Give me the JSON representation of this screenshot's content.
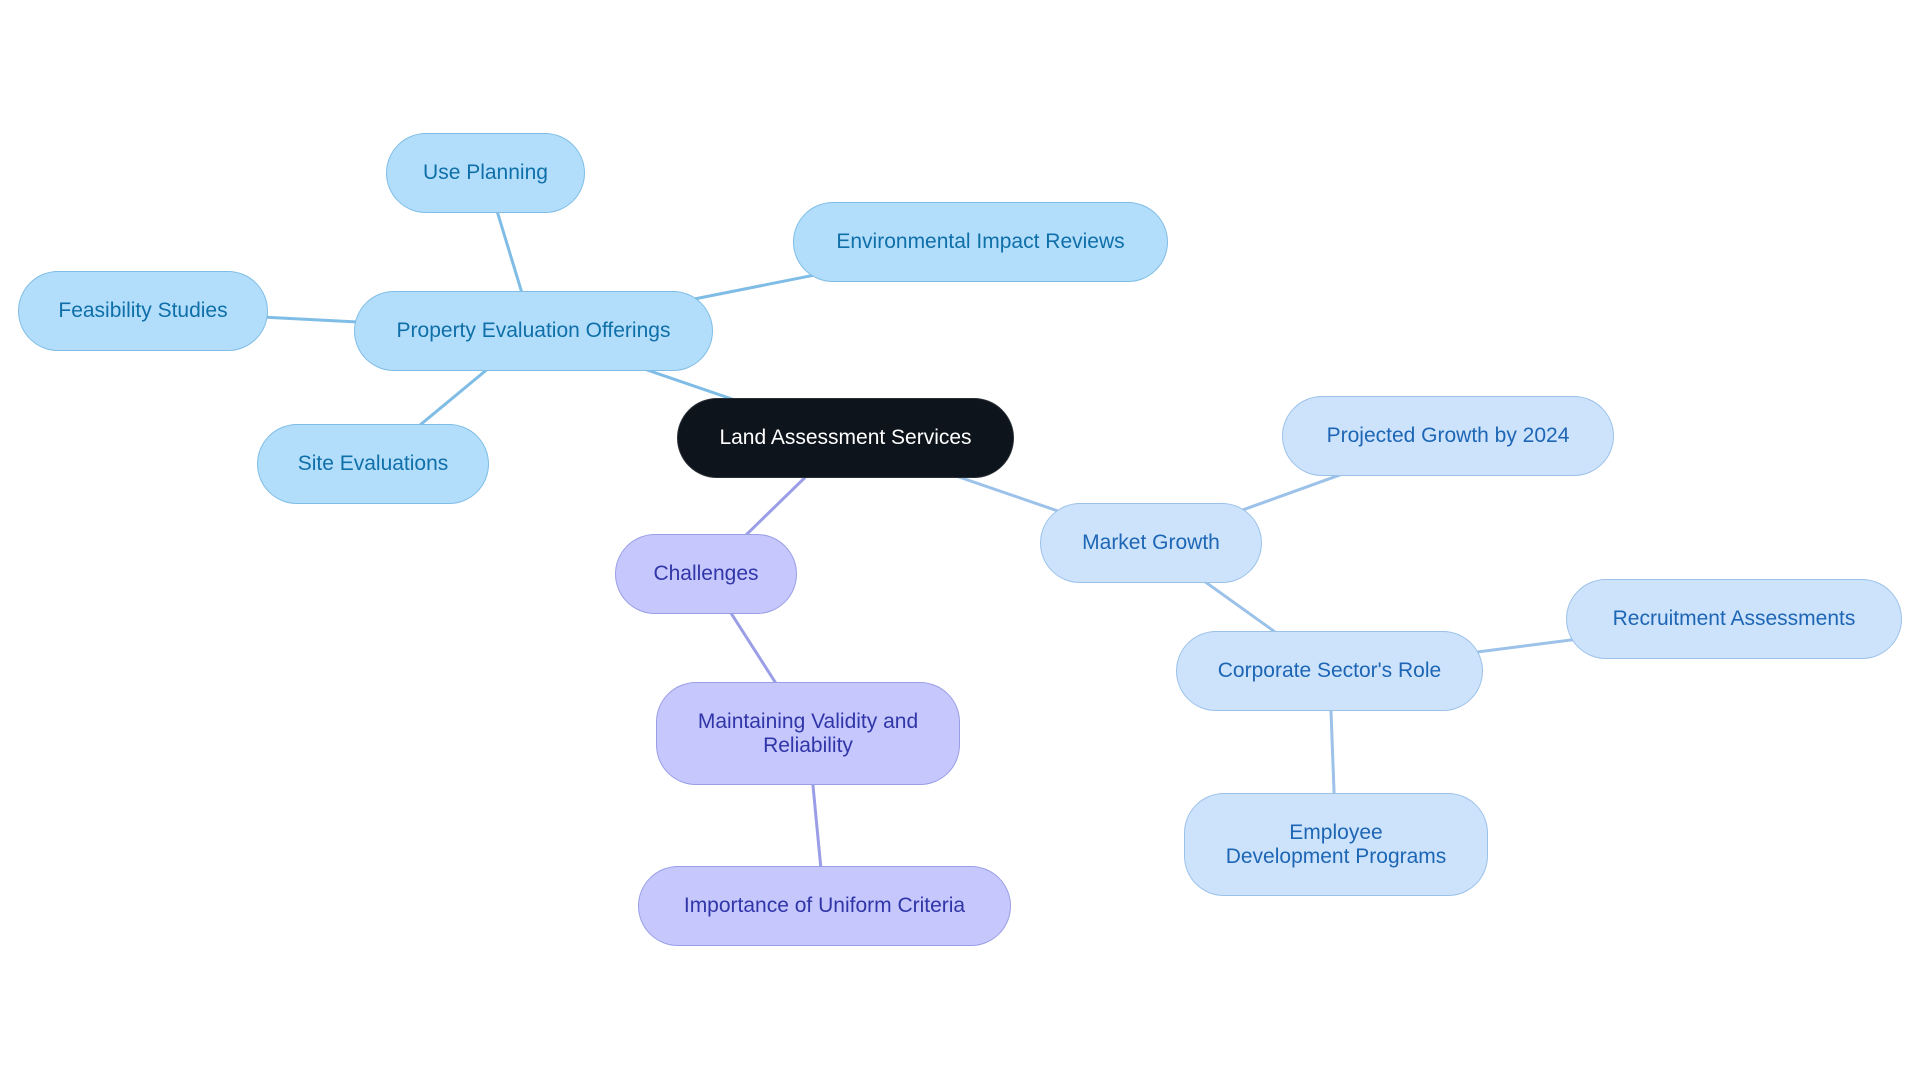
{
  "diagram": {
    "type": "mind-map",
    "root": {
      "id": "root",
      "label": "Land Assessment Services"
    },
    "nodes": [
      {
        "id": "property",
        "label": "Property Evaluation Offerings",
        "parent": "root",
        "group": "g1"
      },
      {
        "id": "use",
        "label": "Use Planning",
        "parent": "property",
        "group": "g1"
      },
      {
        "id": "env",
        "label": "Environmental Impact Reviews",
        "parent": "property",
        "group": "g1"
      },
      {
        "id": "feas",
        "label": "Feasibility Studies",
        "parent": "property",
        "group": "g1"
      },
      {
        "id": "site",
        "label": "Site Evaluations",
        "parent": "property",
        "group": "g1"
      },
      {
        "id": "chal",
        "label": "Challenges",
        "parent": "root",
        "group": "g2"
      },
      {
        "id": "maint",
        "label": "Maintaining Validity and Reliability",
        "parent": "chal",
        "group": "g2"
      },
      {
        "id": "imp",
        "label": "Importance of Uniform Criteria",
        "parent": "maint",
        "group": "g2"
      },
      {
        "id": "market",
        "label": "Market Growth",
        "parent": "root",
        "group": "g3"
      },
      {
        "id": "proj",
        "label": "Projected Growth by 2024",
        "parent": "market",
        "group": "g3"
      },
      {
        "id": "corp",
        "label": "Corporate Sector's Role",
        "parent": "market",
        "group": "g3"
      },
      {
        "id": "recr",
        "label": "Recruitment Assessments",
        "parent": "corp",
        "group": "g3"
      },
      {
        "id": "emp",
        "label": "Employee Development Programs",
        "parent": "corp",
        "group": "g3"
      }
    ],
    "colors": {
      "root_fill": "#0e141c",
      "g1_fill": "#b3defb",
      "g1_edge": "#7fbde6",
      "g1_text": "#0f6fa8",
      "g2_fill": "#c6c8fd",
      "g2_edge": "#9a9ee6",
      "g2_text": "#3035a8",
      "g3_fill": "#cde3fb",
      "g3_edge": "#9cc2ea",
      "g3_text": "#1d66b5"
    }
  }
}
